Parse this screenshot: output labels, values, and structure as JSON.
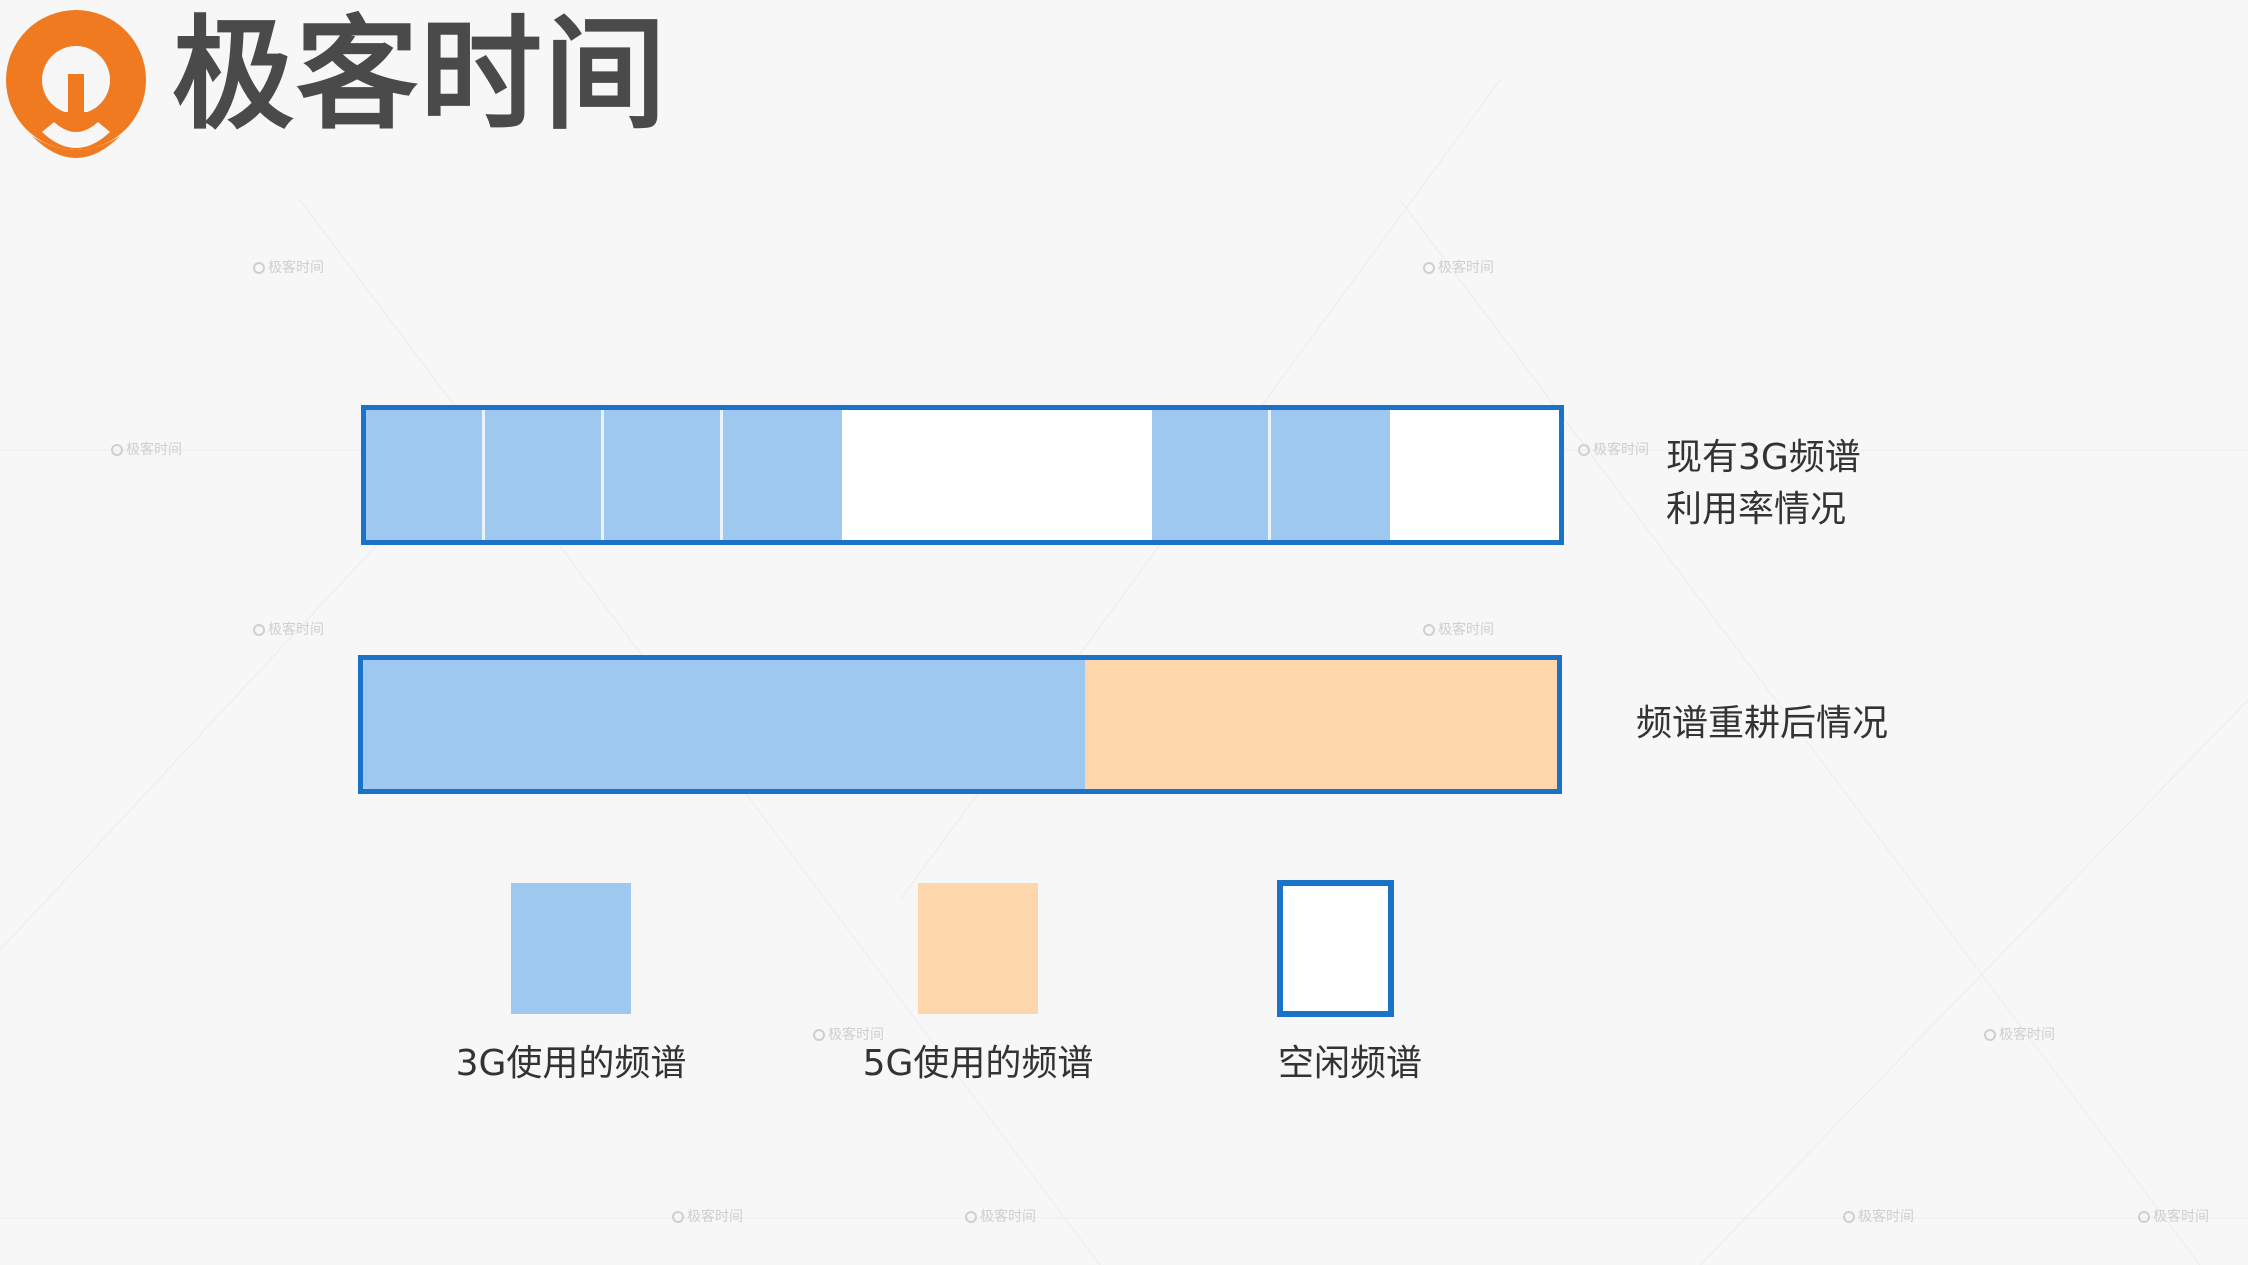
{
  "logo": {
    "text": "极客时间",
    "icon": "geektime-logo-icon",
    "brand_color": "#f07a20"
  },
  "watermark": {
    "text": "极客时间"
  },
  "rows": [
    {
      "label_lines": [
        "现有3G频谱",
        "利用率情况"
      ],
      "segments": [
        {
          "kind": "3g",
          "fraction": 0.1
        },
        {
          "kind": "3g",
          "fraction": 0.1
        },
        {
          "kind": "3g",
          "fraction": 0.1
        },
        {
          "kind": "3g",
          "fraction": 0.1
        },
        {
          "kind": "free",
          "fraction": 0.26
        },
        {
          "kind": "3g",
          "fraction": 0.1
        },
        {
          "kind": "3g",
          "fraction": 0.1
        },
        {
          "kind": "free",
          "fraction": 0.14
        }
      ]
    },
    {
      "label_lines": [
        "频谱重耕后情况"
      ],
      "segments": [
        {
          "kind": "3g",
          "fraction": 0.605
        },
        {
          "kind": "5g",
          "fraction": 0.395
        }
      ]
    }
  ],
  "legend": [
    {
      "kind": "3g",
      "label": "3G使用的频谱"
    },
    {
      "kind": "5g",
      "label": "5G使用的频谱"
    },
    {
      "kind": "free",
      "label": "空闲频谱"
    }
  ],
  "colors": {
    "3g": "#9ec8ef",
    "5g": "#fed6ab",
    "free": "#ffffff",
    "frame": "#1a73c6",
    "text": "#333333"
  }
}
